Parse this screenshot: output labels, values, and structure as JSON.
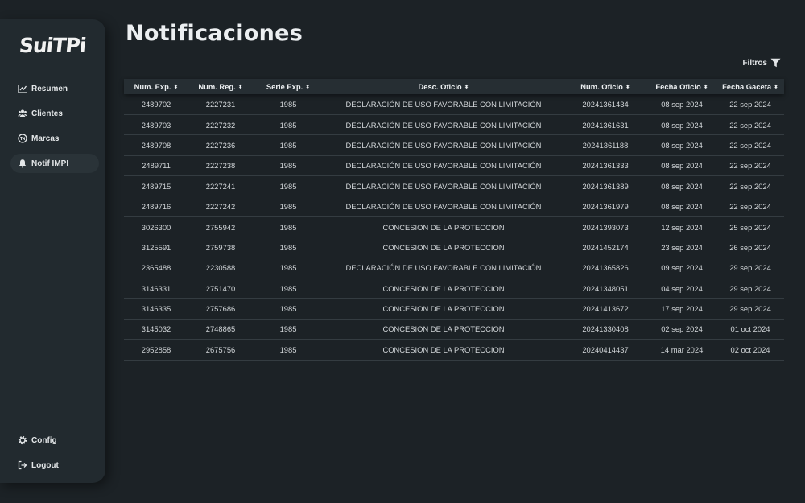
{
  "app": {
    "logo": "SuiTPi"
  },
  "sidebar": {
    "items": [
      {
        "label": "Resumen",
        "icon": "chart-line-icon"
      },
      {
        "label": "Clientes",
        "icon": "users-icon"
      },
      {
        "label": "Marcas",
        "icon": "trademark-icon"
      },
      {
        "label": "Notif IMPI",
        "icon": "bell-icon",
        "active": true
      }
    ],
    "bottom": [
      {
        "label": "Config",
        "icon": "gear-icon"
      },
      {
        "label": "Logout",
        "icon": "logout-icon"
      }
    ]
  },
  "main": {
    "title": "Notificaciones",
    "filters_label": "Filtros"
  },
  "table": {
    "headers": [
      "Num. Exp.",
      "Num. Reg.",
      "Serie Exp.",
      "Desc. Oficio",
      "Num. Oficio",
      "Fecha Oficio",
      "Fecha Gaceta"
    ],
    "rows": [
      [
        "2489702",
        "2227231",
        "1985",
        "DECLARACIÓN DE USO FAVORABLE CON LIMITACIÓN",
        "20241361434",
        "08 sep 2024",
        "22 sep 2024"
      ],
      [
        "2489703",
        "2227232",
        "1985",
        "DECLARACIÓN DE USO FAVORABLE CON LIMITACIÓN",
        "20241361631",
        "08 sep 2024",
        "22 sep 2024"
      ],
      [
        "2489708",
        "2227236",
        "1985",
        "DECLARACIÓN DE USO FAVORABLE CON LIMITACIÓN",
        "20241361188",
        "08 sep 2024",
        "22 sep 2024"
      ],
      [
        "2489711",
        "2227238",
        "1985",
        "DECLARACIÓN DE USO FAVORABLE CON LIMITACIÓN",
        "20241361333",
        "08 sep 2024",
        "22 sep 2024"
      ],
      [
        "2489715",
        "2227241",
        "1985",
        "DECLARACIÓN DE USO FAVORABLE CON LIMITACIÓN",
        "20241361389",
        "08 sep 2024",
        "22 sep 2024"
      ],
      [
        "2489716",
        "2227242",
        "1985",
        "DECLARACIÓN DE USO FAVORABLE CON LIMITACIÓN",
        "20241361979",
        "08 sep 2024",
        "22 sep 2024"
      ],
      [
        "3026300",
        "2755942",
        "1985",
        "CONCESION DE LA PROTECCION",
        "20241393073",
        "12 sep 2024",
        "25 sep 2024"
      ],
      [
        "3125591",
        "2759738",
        "1985",
        "CONCESION DE LA PROTECCION",
        "20241452174",
        "23 sep 2024",
        "26 sep 2024"
      ],
      [
        "2365488",
        "2230588",
        "1985",
        "DECLARACIÓN DE USO FAVORABLE CON LIMITACIÓN",
        "20241365826",
        "09 sep 2024",
        "29 sep 2024"
      ],
      [
        "3146331",
        "2751470",
        "1985",
        "CONCESION DE LA PROTECCION",
        "20241348051",
        "04 sep 2024",
        "29 sep 2024"
      ],
      [
        "3146335",
        "2757686",
        "1985",
        "CONCESION DE LA PROTECCION",
        "20241413672",
        "17 sep 2024",
        "29 sep 2024"
      ],
      [
        "3145032",
        "2748865",
        "1985",
        "CONCESION DE LA PROTECCION",
        "20241330408",
        "02 sep 2024",
        "01 oct 2024"
      ],
      [
        "2952858",
        "2675756",
        "1985",
        "CONCESION DE LA PROTECCION",
        "20240414437",
        "14 mar 2024",
        "02 oct 2024"
      ]
    ]
  },
  "colors": {
    "background": "#1c2226",
    "sidebar": "#222a2f",
    "text": "#d6dadd"
  }
}
